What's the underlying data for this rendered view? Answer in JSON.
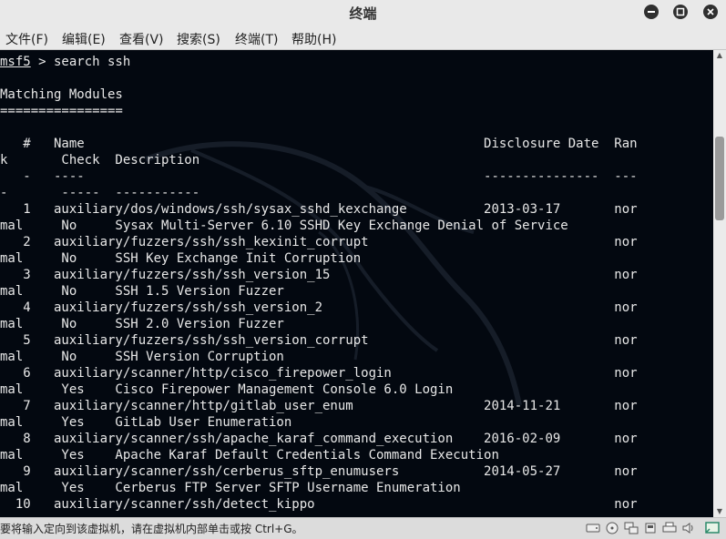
{
  "window": {
    "title": "终端"
  },
  "menu": [
    "文件(F)",
    "编辑(E)",
    "查看(V)",
    "搜索(S)",
    "终端(T)",
    "帮助(H)"
  ],
  "terminal": {
    "lines": [
      "msf5 > search ssh",
      "",
      "Matching Modules",
      "================",
      "",
      "   #   Name                                                    Disclosure Date  Ran",
      "k       Check  Description",
      "   -   ----                                                    ---------------  ---",
      "-       -----  -----------",
      "   1   auxiliary/dos/windows/ssh/sysax_sshd_kexchange          2013-03-17       nor",
      "mal     No     Sysax Multi-Server 6.10 SSHD Key Exchange Denial of Service",
      "   2   auxiliary/fuzzers/ssh/ssh_kexinit_corrupt                                nor",
      "mal     No     SSH Key Exchange Init Corruption",
      "   3   auxiliary/fuzzers/ssh/ssh_version_15                                     nor",
      "mal     No     SSH 1.5 Version Fuzzer",
      "   4   auxiliary/fuzzers/ssh/ssh_version_2                                      nor",
      "mal     No     SSH 2.0 Version Fuzzer",
      "   5   auxiliary/fuzzers/ssh/ssh_version_corrupt                                nor",
      "mal     No     SSH Version Corruption",
      "   6   auxiliary/scanner/http/cisco_firepower_login                             nor",
      "mal     Yes    Cisco Firepower Management Console 6.0 Login",
      "   7   auxiliary/scanner/http/gitlab_user_enum                 2014-11-21       nor",
      "mal     Yes    GitLab User Enumeration",
      "   8   auxiliary/scanner/ssh/apache_karaf_command_execution    2016-02-09       nor",
      "mal     Yes    Apache Karaf Default Credentials Command Execution",
      "   9   auxiliary/scanner/ssh/cerberus_sftp_enumusers           2014-05-27       nor",
      "mal     Yes    Cerberus FTP Server SFTP Username Enumeration",
      "  10   auxiliary/scanner/ssh/detect_kippo                                       nor"
    ],
    "prompt_name": "msf5",
    "prompt_rest": " > search ssh"
  },
  "status": {
    "text": "要将输入定向到该虚拟机，请在虚拟机内部单击或按 Ctrl+G。",
    "icons": [
      "hard-disk-icon",
      "cd-drive-icon",
      "network-icon",
      "usb-icon",
      "printer-icon",
      "sound-icon",
      "message-icon"
    ]
  },
  "colors": {
    "terminal_bg": "#030810",
    "terminal_fg": "#e8e8e8",
    "chrome": "#e9e9e9"
  }
}
